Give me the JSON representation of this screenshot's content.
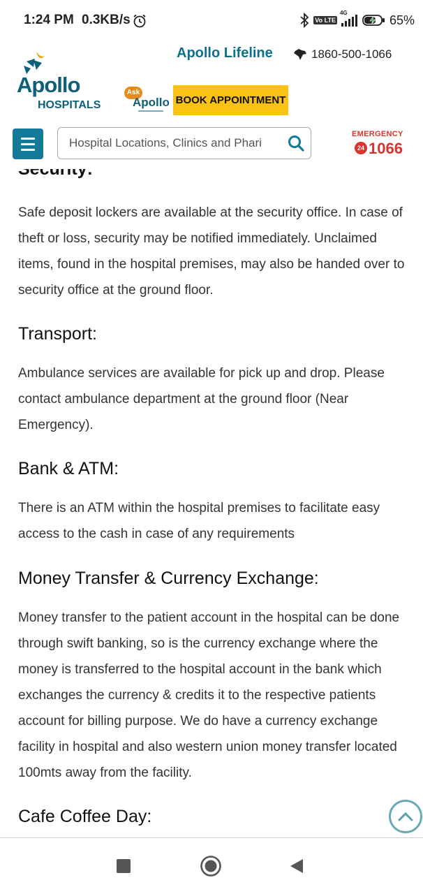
{
  "status_bar": {
    "time": "1:24 PM",
    "speed": "0.3KB/s",
    "network": "4G",
    "volte": "Vo LTE",
    "battery": "65%"
  },
  "header": {
    "logo_text": "Apollo",
    "logo_sub": "HOSPITALS",
    "lifeline": "Apollo Lifeline",
    "phone": "1860-500-1066",
    "ask_label": "Ask",
    "ask_brand": "Apollo",
    "book_button": "BOOK APPOINTMENT",
    "search_placeholder": "Hospital Locations, Clinics and Phari",
    "emergency_label": "EMERGENCY",
    "emergency_badge": "24",
    "emergency_number": "1066"
  },
  "content": {
    "cut_heading": "Security:",
    "security_text": "Safe deposit lockers are available at the security office. In case of theft or loss, security may be notified immediately. Unclaimed items, found in the hospital premises, may also be handed over to security office at the ground floor.",
    "transport_heading": "Transport:",
    "transport_text": "Ambulance services are available for pick up and drop. Please contact ambulance department at the ground floor (Near Emergency).",
    "bank_heading": "Bank & ATM:",
    "bank_text": "There is an ATM within the hospital premises to facilitate easy access to the cash in case of any requirements",
    "money_heading": "Money Transfer & Currency Exchange:",
    "money_text": "Money transfer to the patient account in the hospital can be done through swift banking, so is the currency exchange where the money is transferred to the hospital account in the bank which exchanges the currency & credits it to the respective patients account for billing purpose. We do have a currency exchange facility in hospital and also western union money transfer located 100mts away from the facility.",
    "cafe_heading": "Cafe Coffee Day:"
  },
  "colors": {
    "brand_teal": "#137a9a",
    "book_yellow": "#f9c215",
    "emergency_red": "#d9332d"
  }
}
